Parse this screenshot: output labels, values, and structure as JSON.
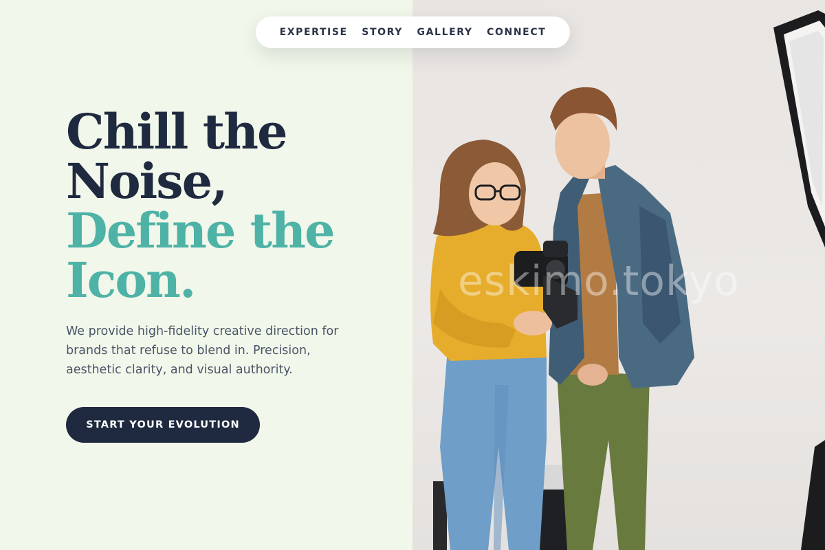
{
  "nav": {
    "items": [
      {
        "label": "EXPERTISE"
      },
      {
        "label": "STORY"
      },
      {
        "label": "GALLERY"
      },
      {
        "label": "CONNECT"
      }
    ]
  },
  "hero": {
    "headline_line1": "Chill the",
    "headline_line2": "Noise,",
    "headline_line3": "Define the",
    "headline_line4": "Icon.",
    "description": "We provide high-fidelity creative direction for brands that refuse to blend in. Precision, aesthetic clarity, and visual authority.",
    "cta_label": "START YOUR EVOLUTION"
  },
  "photo": {
    "watermark": "eskimo.tokyo"
  },
  "colors": {
    "background": "#f1f7ea",
    "navy": "#1f2a40",
    "teal": "#4eb3a6",
    "body_text": "#4b5567"
  }
}
